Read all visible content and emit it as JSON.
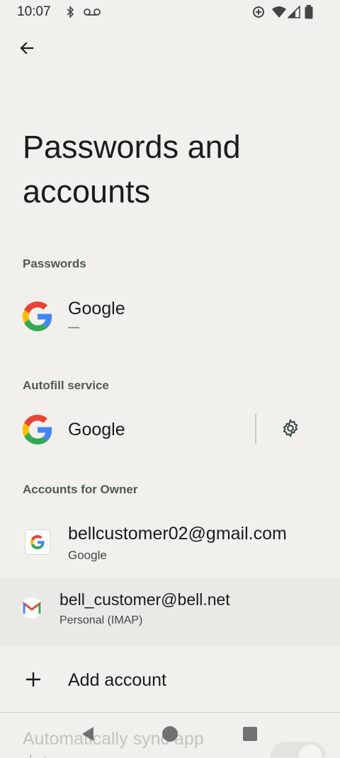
{
  "status_bar": {
    "time": "10:07"
  },
  "header": {
    "title": "Passwords and accounts"
  },
  "passwords": {
    "header": "Passwords",
    "provider": {
      "title": "Google",
      "subtitle": "—"
    }
  },
  "autofill": {
    "header": "Autofill service",
    "provider": {
      "title": "Google"
    }
  },
  "accounts": {
    "header": "Accounts for Owner",
    "items": [
      {
        "email": "bellcustomer02@gmail.com",
        "type": "Google"
      },
      {
        "email": "bell_customer@bell.net",
        "type": "Personal (IMAP)"
      }
    ],
    "add_label": "Add account"
  },
  "sync": {
    "label": "Automatically sync app data"
  },
  "colors": {
    "background": "#f1f0ed",
    "highlight": "#e9e9e6",
    "accent_green": "#4f5a52"
  }
}
